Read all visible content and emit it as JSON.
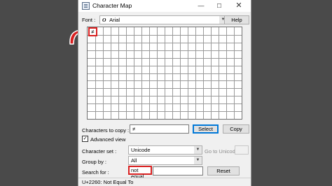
{
  "window": {
    "title": "Character Map",
    "minimize_glyph": "—",
    "maximize_glyph": "☐",
    "close_glyph": "✕"
  },
  "font_row": {
    "label": "Font :",
    "font_icon": "O",
    "value": "Arial",
    "help_label": "Help"
  },
  "grid": {
    "columns": 20,
    "rows": 12,
    "first_char": "≠"
  },
  "copy_row": {
    "label": "Characters to copy :",
    "value": "≠",
    "select_label": "Select",
    "copy_label": "Copy"
  },
  "advanced_view": {
    "label": "Advanced view",
    "checked": true,
    "check_glyph": "✓"
  },
  "character_set": {
    "label": "Character set :",
    "value": "Unicode",
    "goto_label": "Go to Unicode :",
    "goto_value": ""
  },
  "group_by": {
    "label": "Group by :",
    "value": "All"
  },
  "search": {
    "label": "Search for :",
    "value": "not equal",
    "reset_label": "Reset"
  },
  "status": {
    "text": "U+2260: Not Equal To"
  },
  "colors": {
    "highlight": "#d92020",
    "pointer_fill": "#d92020",
    "pointer_outline": "#ffffff",
    "default_button_border": "#0078d7"
  },
  "icons": {
    "pointer": "curved-arrow-icon",
    "app": "character-map-icon",
    "dropdown": "chevron-down-icon"
  }
}
